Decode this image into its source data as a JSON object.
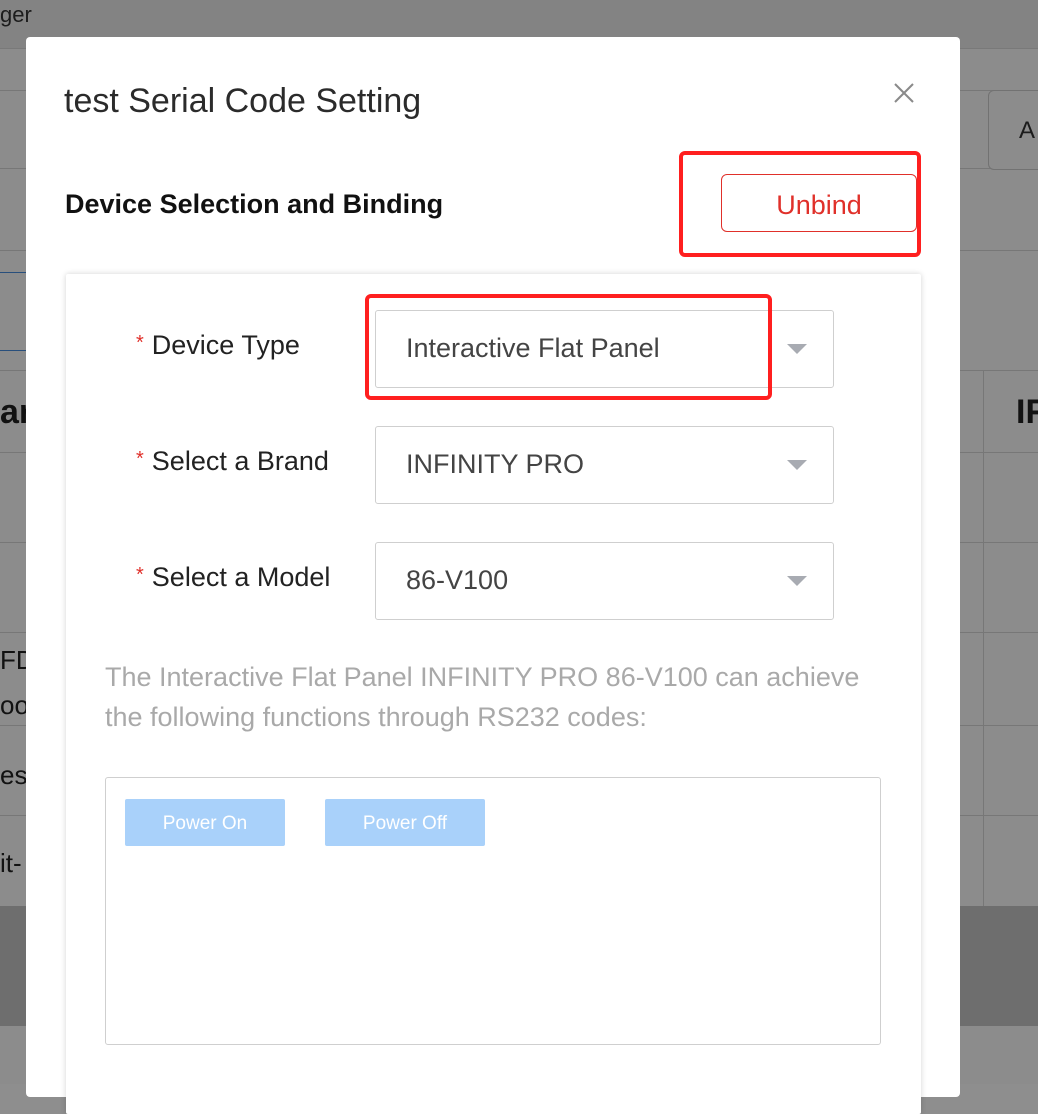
{
  "background": {
    "app_title_fragment": "ger",
    "header_button_fragment": "A",
    "column_header_left": "ar",
    "column_header_right": "IF",
    "row_fragments": [
      "FD",
      "oor",
      "es",
      "it-"
    ]
  },
  "modal": {
    "title": "test Serial Code Setting",
    "section_title": "Device Selection and Binding",
    "unbind_label": "Unbind",
    "form": {
      "device_type": {
        "label": "Device Type",
        "value": "Interactive Flat Panel"
      },
      "brand": {
        "label": "Select a Brand",
        "value": "INFINITY PRO"
      },
      "model": {
        "label": "Select a Model",
        "value": "86-V100"
      }
    },
    "description": "The Interactive Flat Panel INFINITY PRO 86-V100 can achieve the following functions through RS232 codes:",
    "functions": [
      "Power On",
      "Power Off"
    ]
  },
  "colors": {
    "accent_red": "#e0302a",
    "highlight": "#ff1f1f",
    "function_button": "#a9d1fa"
  }
}
